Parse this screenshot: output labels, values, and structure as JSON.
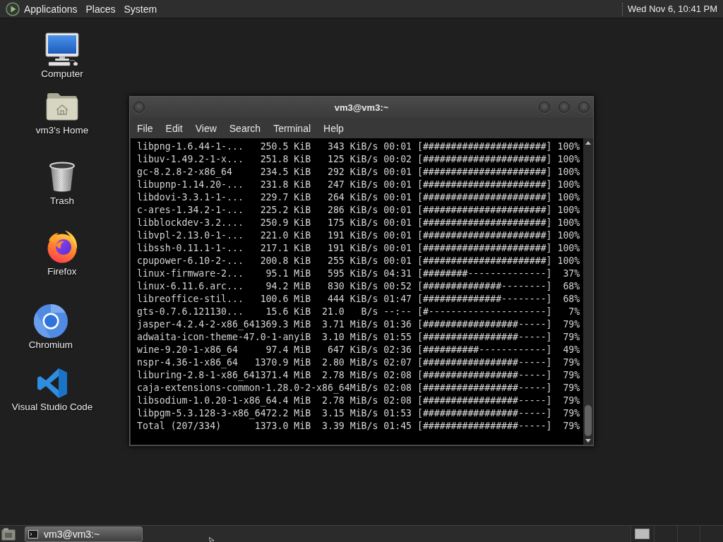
{
  "top_panel": {
    "menus": [
      "Applications",
      "Places",
      "System"
    ],
    "clock": "Wed Nov 6, 10:41 PM"
  },
  "desktop_icons": [
    {
      "label": "Computer"
    },
    {
      "label": "vm3's Home"
    },
    {
      "label": "Trash"
    },
    {
      "label": "Firefox"
    },
    {
      "label": "Chromium"
    },
    {
      "label": "Visual Studio Code"
    }
  ],
  "terminal_window": {
    "title": "vm3@vm3:~",
    "menu": [
      "File",
      "Edit",
      "View",
      "Search",
      "Terminal",
      "Help"
    ],
    "lines": [
      "libpng-1.6.44-1-...   250.5 KiB   343 KiB/s 00:01 [######################] 100%",
      "libuv-1.49.2-1-x...   251.8 KiB   125 KiB/s 00:02 [######################] 100%",
      "gc-8.2.8-2-x86_64     234.5 KiB   292 KiB/s 00:01 [######################] 100%",
      "libupnp-1.14.20-...   231.8 KiB   247 KiB/s 00:01 [######################] 100%",
      "libdovi-3.3.1-1-...   229.7 KiB   264 KiB/s 00:01 [######################] 100%",
      "c-ares-1.34.2-1-...   225.2 KiB   286 KiB/s 00:01 [######################] 100%",
      "libblockdev-3.2....   250.9 KiB   175 KiB/s 00:01 [######################] 100%",
      "libvpl-2.13.0-1-...   221.0 KiB   191 KiB/s 00:01 [######################] 100%",
      "libssh-0.11.1-1-...   217.1 KiB   191 KiB/s 00:01 [######################] 100%",
      "cpupower-6.10-2-...   200.8 KiB   255 KiB/s 00:01 [######################] 100%",
      "linux-firmware-2...    95.1 MiB   595 KiB/s 04:31 [########--------------]  37%",
      "linux-6.11.6.arc...    94.2 MiB   830 KiB/s 00:52 [##############--------]  68%",
      "libreoffice-stil...   100.6 MiB   444 KiB/s 01:47 [##############--------]  68%",
      "gts-0.7.6.121130...    15.6 KiB  21.0   B/s --:-- [#---------------------]   7%",
      "jasper-4.2.4-2-x86_641369.3 MiB  3.71 MiB/s 01:36 [#################-----]  79%",
      "adwaita-icon-theme-47.0-1-anyiB  3.10 MiB/s 01:55 [#################-----]  79%",
      "wine-9.20-1-x86_64     97.4 MiB   647 KiB/s 02:36 [##########------------]  49%",
      "nspr-4.36-1-x86_64   1370.9 MiB  2.80 MiB/s 02:07 [#################-----]  79%",
      "liburing-2.8-1-x86_641371.4 MiB  2.78 MiB/s 02:08 [#################-----]  79%",
      "caja-extensions-common-1.28.0-2-x86_64MiB/s 02:08 [#################-----]  79%",
      "libsodium-1.0.20-1-x86_64.4 MiB  2.78 MiB/s 02:08 [#################-----]  79%",
      "libpgm-5.3.128-3-x86_6472.2 MiB  3.15 MiB/s 01:53 [#################-----]  79%",
      "Total (207/334)      1373.0 MiB  3.39 MiB/s 01:45 [#################-----]  79%"
    ]
  },
  "taskbar": {
    "windows": [
      {
        "title": "vm3@vm3:~",
        "selected": true
      }
    ]
  }
}
